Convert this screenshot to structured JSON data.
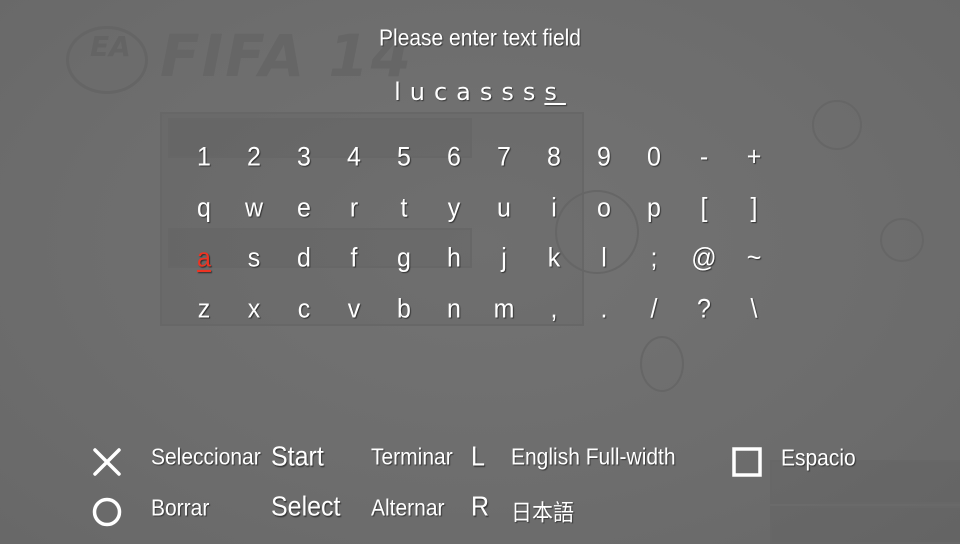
{
  "prompt": "Please enter text field",
  "entry": {
    "text": "lucasss",
    "cursor_char": "s"
  },
  "keyboard": {
    "selected": "a",
    "rows": [
      [
        "1",
        "2",
        "3",
        "4",
        "5",
        "6",
        "7",
        "8",
        "9",
        "0",
        "-",
        "+"
      ],
      [
        "q",
        "w",
        "e",
        "r",
        "t",
        "y",
        "u",
        "i",
        "o",
        "p",
        "[",
        "]"
      ],
      [
        "a",
        "s",
        "d",
        "f",
        "g",
        "h",
        "j",
        "k",
        "l",
        ";",
        "@",
        "~"
      ],
      [
        "z",
        "x",
        "c",
        "v",
        "b",
        "n",
        "m",
        ",",
        ".",
        "/",
        "?",
        "\\"
      ]
    ]
  },
  "help": {
    "cross_label": "Seleccionar",
    "circle_label": "Borrar",
    "start_button": "Start",
    "start_label": "Terminar",
    "select_button": "Select",
    "select_label": "Alternar",
    "l_button": "L",
    "l_label": "English Full-width",
    "r_button": "R",
    "r_label": "日本語",
    "square_label": "Espacio"
  },
  "background": {
    "title": "FIFA 14",
    "logo": "EA"
  },
  "colors": {
    "overlay": "#6f6f6f",
    "text": "#ffffff",
    "selected_key": "#ee3322"
  }
}
